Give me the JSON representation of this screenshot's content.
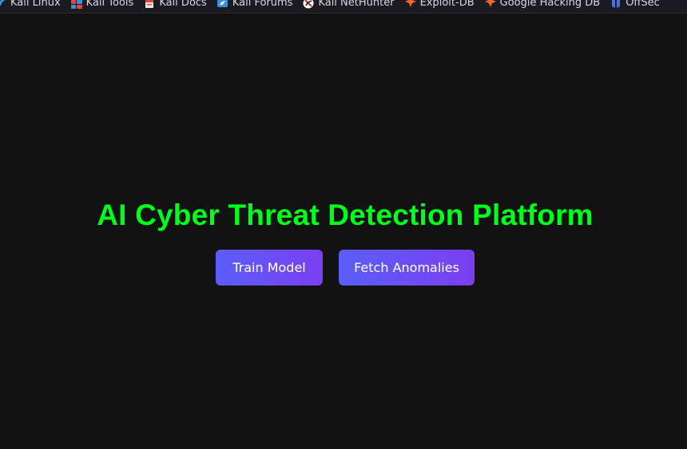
{
  "bookmarks": [
    {
      "label": "Kali Linux",
      "icon": "kali-dragon-icon"
    },
    {
      "label": "Kali Tools",
      "icon": "kali-tools-icon"
    },
    {
      "label": "Kali Docs",
      "icon": "kali-docs-icon"
    },
    {
      "label": "Kali Forums",
      "icon": "kali-forums-icon"
    },
    {
      "label": "Kali NetHunter",
      "icon": "kali-nethunter-icon"
    },
    {
      "label": "Exploit-DB",
      "icon": "exploit-db-icon"
    },
    {
      "label": "Google Hacking DB",
      "icon": "google-hacking-db-icon"
    },
    {
      "label": "OffSec",
      "icon": "offsec-icon"
    }
  ],
  "main": {
    "title": "AI Cyber Threat Detection Platform",
    "train_button_label": "Train Model",
    "fetch_button_label": "Fetch Anomalies"
  },
  "colors": {
    "page_background": "#121212",
    "title": "#00ff1a",
    "button_gradient_start": "#5a5ef8",
    "button_gradient_end": "#7b3ff0"
  }
}
